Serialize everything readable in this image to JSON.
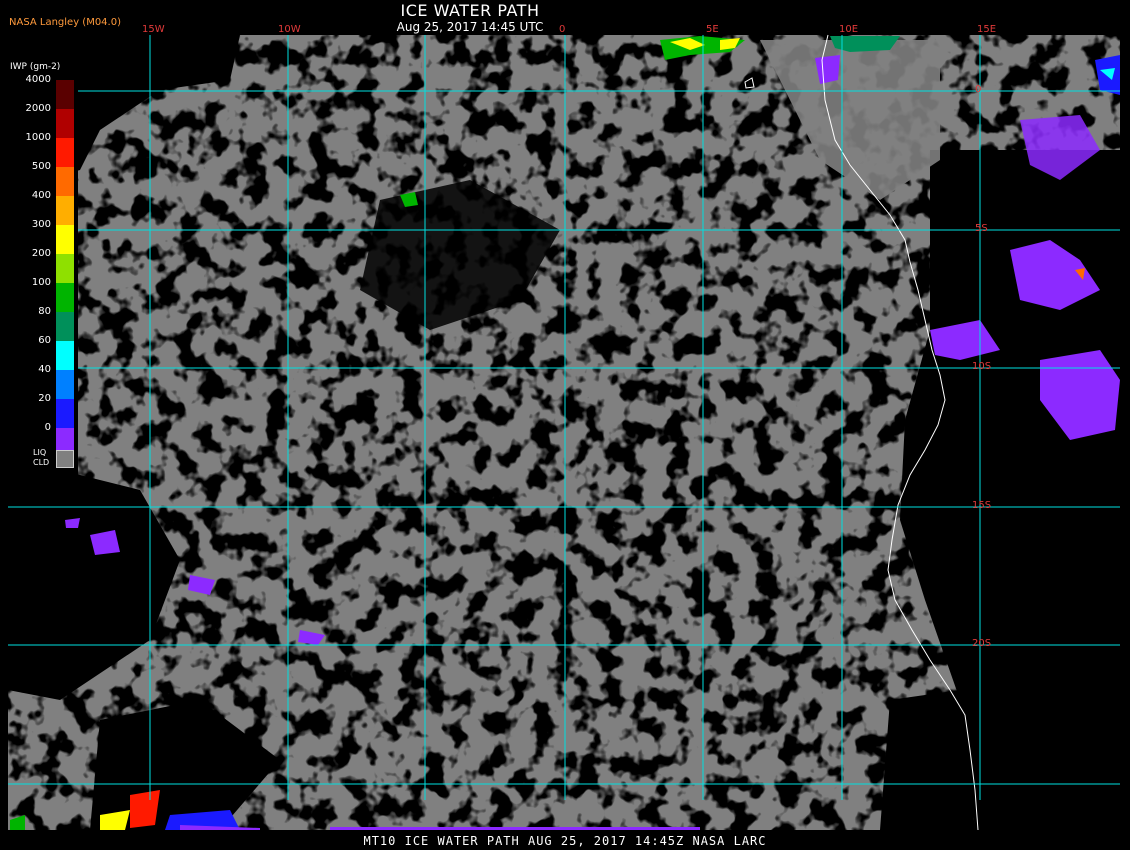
{
  "title": "ICE WATER PATH",
  "subtitle": "Aug 25, 2017 14:45 UTC",
  "producer": "NASA Langley (M04.0)",
  "footer": "MT10  ICE WATER PATH  AUG 25, 2017 14:45Z  NASA LARC",
  "legend": {
    "title": "IWP (gm-2)",
    "levels": [
      {
        "label": "4000",
        "color": "#5a0000"
      },
      {
        "label": "2000",
        "color": "#b00000"
      },
      {
        "label": "1000",
        "color": "#ff1a00"
      },
      {
        "label": "500",
        "color": "#ff6a00"
      },
      {
        "label": "400",
        "color": "#ffae00"
      },
      {
        "label": "300",
        "color": "#ffff00"
      },
      {
        "label": "200",
        "color": "#8fe000"
      },
      {
        "label": "100",
        "color": "#00b400"
      },
      {
        "label": "80",
        "color": "#00905a"
      },
      {
        "label": "60",
        "color": "#00ffff"
      },
      {
        "label": "40",
        "color": "#0080ff"
      },
      {
        "label": "20",
        "color": "#1a1aff"
      },
      {
        "label": "0",
        "color": "#8c2aff"
      }
    ],
    "liq_label_1": "LIQ",
    "liq_label_2": "CLD",
    "liq_color": "#808080"
  },
  "longitude_labels": [
    "15W",
    "10W",
    "0",
    "5E",
    "10E",
    "15E"
  ],
  "latitude_labels": [
    "0",
    "5S",
    "10S",
    "15S",
    "20S"
  ],
  "colors": {
    "grid": "#00e0e0",
    "cloud": "#808080",
    "clear": "#000000",
    "coast": "#ffffff",
    "tick_labels": "#e23a3a"
  }
}
